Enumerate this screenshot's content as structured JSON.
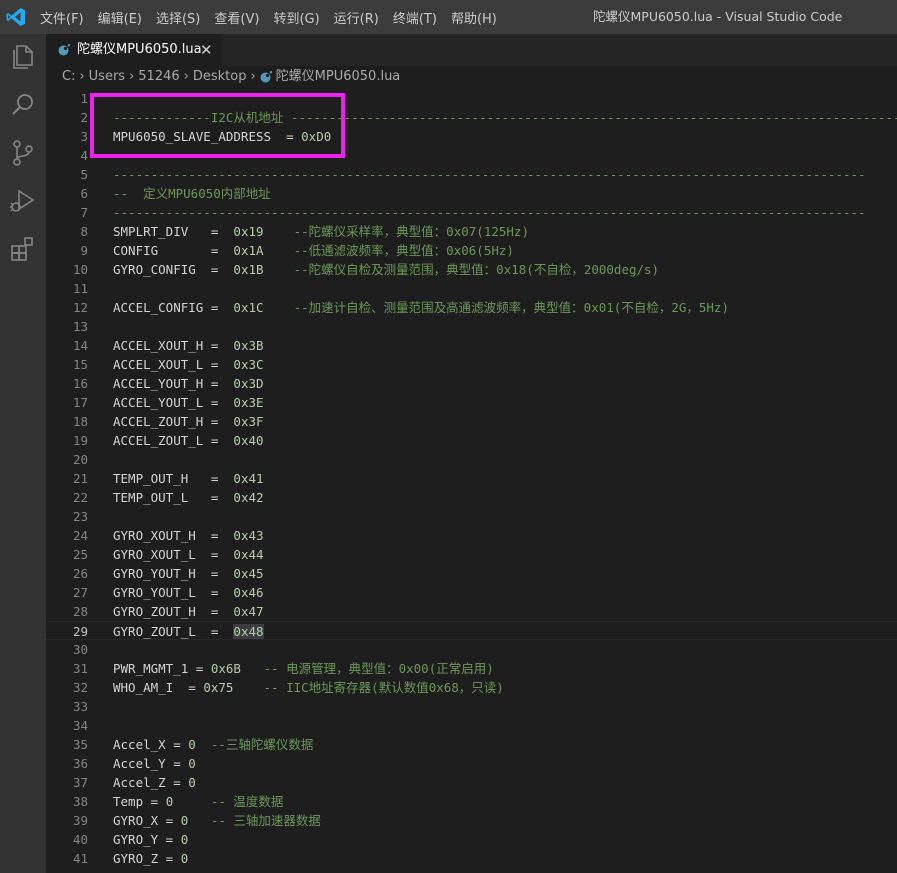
{
  "titlebar": {
    "menu": [
      "文件(F)",
      "编辑(E)",
      "选择(S)",
      "查看(V)",
      "转到(G)",
      "运行(R)",
      "终端(T)",
      "帮助(H)"
    ],
    "window_title": "陀螺仪MPU6050.lua - Visual Studio Code"
  },
  "activity_bar": {
    "icons": [
      "explorer-icon",
      "search-icon",
      "source-control-icon",
      "run-debug-icon",
      "extensions-icon"
    ]
  },
  "tab": {
    "filename": "陀螺仪MPU6050.lua",
    "close_label": "✕"
  },
  "breadcrumbs": [
    "C:",
    "Users",
    "51246",
    "Desktop",
    "陀螺仪MPU6050.lua"
  ],
  "editor": {
    "active_line": 29,
    "lines": [
      {
        "n": "1",
        "segs": []
      },
      {
        "n": "2",
        "segs": [
          {
            "t": "-------------I2C从机地址 ----------------------------------------------------------------------------------",
            "k": "c"
          }
        ]
      },
      {
        "n": "3",
        "segs": [
          {
            "t": "MPU6050_SLAVE_ADDRESS  = ",
            "k": ""
          },
          {
            "t": "0xD0",
            "k": "n"
          }
        ]
      },
      {
        "n": "4",
        "segs": []
      },
      {
        "n": "5",
        "segs": [
          {
            "t": "----------------------------------------------------------------------------------------------------",
            "k": "c"
          }
        ]
      },
      {
        "n": "6",
        "segs": [
          {
            "t": "--  定义MPU6050内部地址",
            "k": "c"
          }
        ]
      },
      {
        "n": "7",
        "segs": [
          {
            "t": "----------------------------------------------------------------------------------------------------",
            "k": "c"
          }
        ]
      },
      {
        "n": "8",
        "segs": [
          {
            "t": "SMPLRT_DIV   =  ",
            "k": ""
          },
          {
            "t": "0x19",
            "k": "n"
          },
          {
            "t": "    --陀螺仪采样率，典型值：0x07(125Hz)",
            "k": "c"
          }
        ]
      },
      {
        "n": "9",
        "segs": [
          {
            "t": "CONFIG       =  ",
            "k": ""
          },
          {
            "t": "0x1A",
            "k": "n"
          },
          {
            "t": "    --低通滤波频率，典型值：0x06(5Hz)",
            "k": "c"
          }
        ]
      },
      {
        "n": "10",
        "segs": [
          {
            "t": "GYRO_CONFIG  =  ",
            "k": ""
          },
          {
            "t": "0x1B",
            "k": "n"
          },
          {
            "t": "    --陀螺仪自检及测量范围，典型值：0x18(不自检，2000deg/s)",
            "k": "c"
          }
        ]
      },
      {
        "n": "11",
        "segs": []
      },
      {
        "n": "12",
        "segs": [
          {
            "t": "ACCEL_CONFIG =  ",
            "k": ""
          },
          {
            "t": "0x1C",
            "k": "n"
          },
          {
            "t": "    --加速计自检、测量范围及高通滤波频率，典型值：0x01(不自检，2G，5Hz)",
            "k": "c"
          }
        ]
      },
      {
        "n": "13",
        "segs": []
      },
      {
        "n": "14",
        "segs": [
          {
            "t": "ACCEL_XOUT_H =  ",
            "k": ""
          },
          {
            "t": "0x3B",
            "k": "n"
          }
        ]
      },
      {
        "n": "15",
        "segs": [
          {
            "t": "ACCEL_XOUT_L =  ",
            "k": ""
          },
          {
            "t": "0x3C",
            "k": "n"
          }
        ]
      },
      {
        "n": "16",
        "segs": [
          {
            "t": "ACCEL_YOUT_H =  ",
            "k": ""
          },
          {
            "t": "0x3D",
            "k": "n"
          }
        ]
      },
      {
        "n": "17",
        "segs": [
          {
            "t": "ACCEL_YOUT_L =  ",
            "k": ""
          },
          {
            "t": "0x3E",
            "k": "n"
          }
        ]
      },
      {
        "n": "18",
        "segs": [
          {
            "t": "ACCEL_ZOUT_H =  ",
            "k": ""
          },
          {
            "t": "0x3F",
            "k": "n"
          }
        ]
      },
      {
        "n": "19",
        "segs": [
          {
            "t": "ACCEL_ZOUT_L =  ",
            "k": ""
          },
          {
            "t": "0x40",
            "k": "n"
          }
        ]
      },
      {
        "n": "20",
        "segs": []
      },
      {
        "n": "21",
        "segs": [
          {
            "t": "TEMP_OUT_H   =  ",
            "k": ""
          },
          {
            "t": "0x41",
            "k": "n"
          }
        ]
      },
      {
        "n": "22",
        "segs": [
          {
            "t": "TEMP_OUT_L   =  ",
            "k": ""
          },
          {
            "t": "0x42",
            "k": "n"
          }
        ]
      },
      {
        "n": "23",
        "segs": []
      },
      {
        "n": "24",
        "segs": [
          {
            "t": "GYRO_XOUT_H  =  ",
            "k": ""
          },
          {
            "t": "0x43",
            "k": "n"
          }
        ]
      },
      {
        "n": "25",
        "segs": [
          {
            "t": "GYRO_XOUT_L  =  ",
            "k": ""
          },
          {
            "t": "0x44",
            "k": "n"
          }
        ]
      },
      {
        "n": "26",
        "segs": [
          {
            "t": "GYRO_YOUT_H  =  ",
            "k": ""
          },
          {
            "t": "0x45",
            "k": "n"
          }
        ]
      },
      {
        "n": "27",
        "segs": [
          {
            "t": "GYRO_YOUT_L  =  ",
            "k": ""
          },
          {
            "t": "0x46",
            "k": "n"
          }
        ]
      },
      {
        "n": "28",
        "segs": [
          {
            "t": "GYRO_ZOUT_H  =  ",
            "k": ""
          },
          {
            "t": "0x47",
            "k": "n"
          }
        ]
      },
      {
        "n": "29",
        "segs": [
          {
            "t": "GYRO_ZOUT_L  =  ",
            "k": ""
          },
          {
            "t": "0x48",
            "k": "n hl"
          }
        ]
      },
      {
        "n": "30",
        "segs": []
      },
      {
        "n": "31",
        "segs": [
          {
            "t": "PWR_MGMT_1 = ",
            "k": ""
          },
          {
            "t": "0x6B",
            "k": "n"
          },
          {
            "t": "   -- 电源管理，典型值：0x00(正常启用)",
            "k": "c"
          }
        ]
      },
      {
        "n": "32",
        "segs": [
          {
            "t": "WHO_AM_I  = ",
            "k": ""
          },
          {
            "t": "0x75",
            "k": "n"
          },
          {
            "t": "    -- IIC地址寄存器(默认数值0x68，只读)",
            "k": "c"
          }
        ]
      },
      {
        "n": "33",
        "segs": []
      },
      {
        "n": "34",
        "segs": []
      },
      {
        "n": "35",
        "segs": [
          {
            "t": "Accel_X = ",
            "k": ""
          },
          {
            "t": "0",
            "k": "n"
          },
          {
            "t": "  --三轴陀螺仪数据",
            "k": "c"
          }
        ]
      },
      {
        "n": "36",
        "segs": [
          {
            "t": "Accel_Y = ",
            "k": ""
          },
          {
            "t": "0",
            "k": "n"
          }
        ]
      },
      {
        "n": "37",
        "segs": [
          {
            "t": "Accel_Z = ",
            "k": ""
          },
          {
            "t": "0",
            "k": "n"
          }
        ]
      },
      {
        "n": "38",
        "segs": [
          {
            "t": "Temp = ",
            "k": ""
          },
          {
            "t": "0",
            "k": "n"
          },
          {
            "t": "     -- 温度数据",
            "k": "c"
          }
        ]
      },
      {
        "n": "39",
        "segs": [
          {
            "t": "GYRO_X = ",
            "k": ""
          },
          {
            "t": "0",
            "k": "n"
          },
          {
            "t": "   -- 三轴加速器数据",
            "k": "c"
          }
        ]
      },
      {
        "n": "40",
        "segs": [
          {
            "t": "GYRO_Y = ",
            "k": ""
          },
          {
            "t": "0",
            "k": "n"
          }
        ]
      },
      {
        "n": "41",
        "segs": [
          {
            "t": "GYRO_Z = ",
            "k": ""
          },
          {
            "t": "0",
            "k": "n"
          }
        ]
      }
    ]
  },
  "colors": {
    "highlight_box": "#ee22ee",
    "comment": "#6a9955",
    "number": "#b5cea8",
    "text": "#d4d4d4",
    "vscode_blue": "#23a9f2",
    "lua_icon": "#519aba"
  }
}
